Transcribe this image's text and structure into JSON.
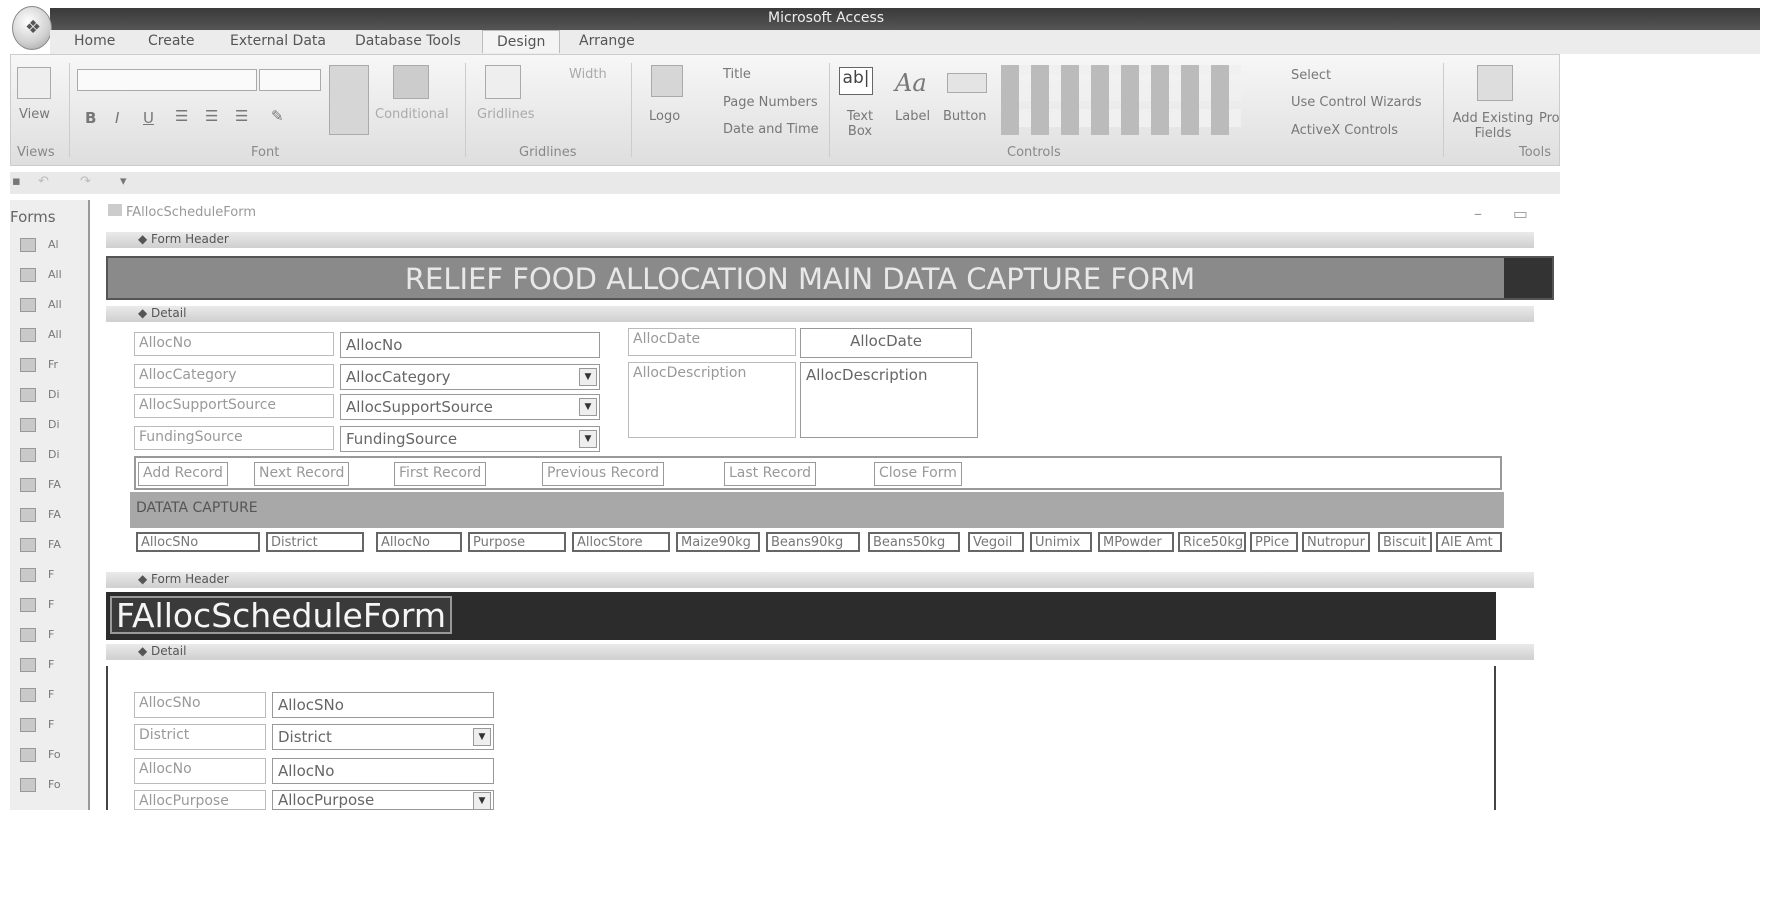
{
  "window": {
    "title": "Microsoft Access"
  },
  "ribbon": {
    "tabs": [
      "Home",
      "Create",
      "External Data",
      "Database Tools",
      "Design",
      "Arrange"
    ],
    "active_tab": "Design",
    "views": {
      "view_label": "View",
      "group": "Views"
    },
    "font": {
      "conditional_label": "Conditional",
      "group": "Font"
    },
    "gridlines": {
      "gridlines_label": "Gridlines",
      "width_label": "Width",
      "group": "Gridlines"
    },
    "header": {
      "logo_label": "Logo",
      "title_label": "Title",
      "page_numbers_label": "Page Numbers",
      "date_time_label": "Date and Time"
    },
    "controls": {
      "text_box_label": "Text Box",
      "label_label": "Label",
      "button_label": "Button",
      "select_label": "Select",
      "wizards_label": "Use Control Wizards",
      "activex_label": "ActiveX Controls",
      "group": "Controls"
    },
    "tools": {
      "add_fields_label": "Add Existing Fields",
      "pro_label": "Pro",
      "group": "Tools"
    }
  },
  "nav": {
    "header": "Forms",
    "items": [
      "Al",
      "All",
      "All",
      "All",
      "Fr",
      "Di",
      "Di",
      "Di",
      "FA",
      "FA",
      "FA",
      "F",
      "F",
      "F",
      "F",
      "F",
      "F",
      "Fo",
      "Fo"
    ]
  },
  "doc": {
    "tab_title": "FAllocScheduleForm"
  },
  "form1": {
    "section_header": "Form Header",
    "title": "RELIEF FOOD ALLOCATION MAIN DATA CAPTURE FORM",
    "section_detail": "Detail",
    "fields": [
      {
        "label": "AllocNo",
        "value": "AllocNo"
      },
      {
        "label": "AllocCategory",
        "value": "AllocCategory"
      },
      {
        "label": "AllocSupportSource",
        "value": "AllocSupportSource"
      },
      {
        "label": "FundingSource",
        "value": "FundingSource"
      }
    ],
    "right_fields": [
      {
        "label": "AllocDate",
        "value": "AllocDate"
      },
      {
        "label": "AllocDescription",
        "value": "AllocDescription"
      }
    ],
    "buttons": [
      "Add Record",
      "Next Record",
      "First Record",
      "Previous Record",
      "Last Record",
      "Close Form"
    ],
    "capture_label": "DATATA CAPTURE",
    "columns": [
      "AllocSNo",
      "District",
      "AllocNo",
      "Purpose",
      "AllocStore",
      "Maize90kg",
      "Beans90kg",
      "Beans50kg",
      "Vegoil",
      "Unimix",
      "MPowder",
      "Rice50kg",
      "PPice",
      "Nutropur",
      "Biscuit",
      "AIE Amt"
    ]
  },
  "form2": {
    "section_header": "Form Header",
    "title": "FAllocScheduleForm",
    "section_detail": "Detail",
    "fields": [
      {
        "label": "AllocSNo",
        "value": "AllocSNo"
      },
      {
        "label": "District",
        "value": "District"
      },
      {
        "label": "AllocNo",
        "value": "AllocNo"
      },
      {
        "label": "AllocPurpose",
        "value": "AllocPurpose"
      }
    ]
  }
}
